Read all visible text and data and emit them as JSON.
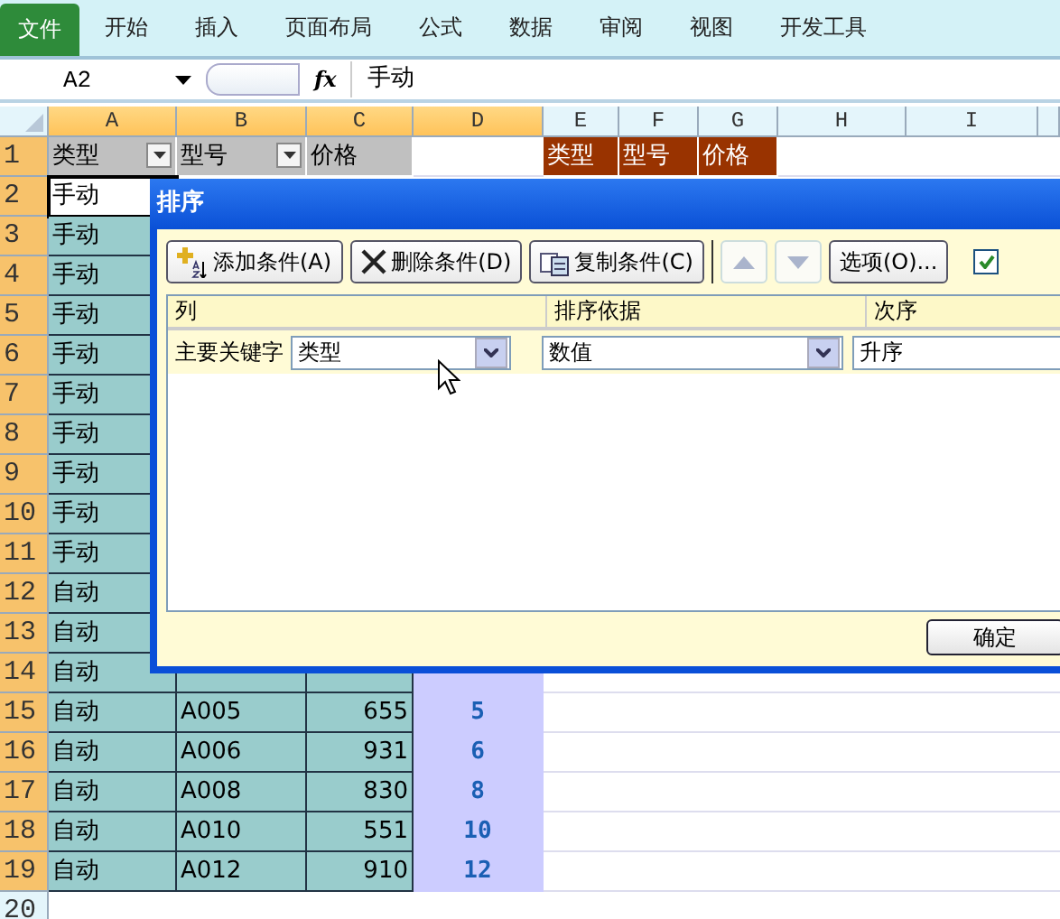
{
  "ribbon": {
    "tabs": [
      {
        "label": "文件",
        "selected": true
      },
      {
        "label": "开始",
        "selected": false
      },
      {
        "label": "插入",
        "selected": false
      },
      {
        "label": "页面布局",
        "selected": false
      },
      {
        "label": "公式",
        "selected": false
      },
      {
        "label": "数据",
        "selected": false
      },
      {
        "label": "审阅",
        "selected": false
      },
      {
        "label": "视图",
        "selected": false
      },
      {
        "label": "开发工具",
        "selected": false
      }
    ]
  },
  "formula_bar": {
    "name_box": "A2",
    "fx": "fx",
    "value": "手动"
  },
  "sheet": {
    "columns": [
      {
        "label": "A",
        "selected": true
      },
      {
        "label": "B",
        "selected": true
      },
      {
        "label": "C",
        "selected": true
      },
      {
        "label": "D",
        "selected": true
      },
      {
        "label": "E",
        "selected": false
      },
      {
        "label": "F",
        "selected": false
      },
      {
        "label": "G",
        "selected": false
      },
      {
        "label": "H",
        "selected": false
      },
      {
        "label": "I",
        "selected": false
      }
    ],
    "rows": [
      {
        "number": "1",
        "selected": true,
        "cells": {
          "A": {
            "kind": "field",
            "text": "类型",
            "filter": true
          },
          "B": {
            "kind": "field",
            "text": "型号",
            "filter": true
          },
          "C": {
            "kind": "field",
            "text": "价格"
          },
          "E": {
            "kind": "criteria",
            "text": "类型"
          },
          "F": {
            "kind": "criteria",
            "text": "型号"
          },
          "G": {
            "kind": "criteria",
            "text": "价格"
          }
        }
      },
      {
        "number": "2",
        "selected": true,
        "cells": {
          "A": {
            "kind": "text",
            "text": "手动",
            "active": true
          }
        }
      },
      {
        "number": "3",
        "selected": true,
        "cells": {
          "A": {
            "kind": "text",
            "text": "手动",
            "active": false
          }
        }
      },
      {
        "number": "4",
        "selected": true,
        "cells": {
          "A": {
            "kind": "text",
            "text": "手动",
            "active": false
          }
        }
      },
      {
        "number": "5",
        "selected": true,
        "cells": {
          "A": {
            "kind": "text",
            "text": "手动",
            "active": false
          }
        }
      },
      {
        "number": "6",
        "selected": true,
        "cells": {
          "A": {
            "kind": "text",
            "text": "手动",
            "active": false
          }
        }
      },
      {
        "number": "7",
        "selected": true,
        "cells": {
          "A": {
            "kind": "text",
            "text": "手动",
            "active": false
          }
        }
      },
      {
        "number": "8",
        "selected": true,
        "cells": {
          "A": {
            "kind": "text",
            "text": "手动",
            "active": false
          }
        }
      },
      {
        "number": "9",
        "selected": true,
        "cells": {
          "A": {
            "kind": "text",
            "text": "手动",
            "active": false
          }
        }
      },
      {
        "number": "10",
        "selected": true,
        "cells": {
          "A": {
            "kind": "text",
            "text": "手动",
            "active": false
          }
        }
      },
      {
        "number": "11",
        "selected": true,
        "cells": {
          "A": {
            "kind": "text",
            "text": "手动",
            "active": false
          }
        }
      },
      {
        "number": "12",
        "selected": true,
        "cells": {
          "A": {
            "kind": "text",
            "text": "自动",
            "active": false
          }
        }
      },
      {
        "number": "13",
        "selected": true,
        "cells": {
          "A": {
            "kind": "text",
            "text": "自动",
            "active": false
          }
        }
      },
      {
        "number": "14",
        "selected": true,
        "cells": {
          "A": {
            "kind": "text",
            "text": "自动",
            "active": false
          },
          "B": {
            "kind": "text",
            "active": false
          },
          "C": {
            "kind": "number",
            "active": false
          },
          "D": {
            "kind": "rank",
            "active": false
          }
        }
      },
      {
        "number": "15",
        "selected": true,
        "cells": {
          "A": {
            "kind": "text",
            "text": "自动",
            "active": false
          },
          "B": {
            "kind": "text",
            "text": "A005",
            "active": false
          },
          "C": {
            "kind": "number",
            "text": "655",
            "active": false
          },
          "D": {
            "kind": "rank",
            "text": "5",
            "active": false
          }
        }
      },
      {
        "number": "16",
        "selected": true,
        "cells": {
          "A": {
            "kind": "text",
            "text": "自动",
            "active": false
          },
          "B": {
            "kind": "text",
            "text": "A006",
            "active": false
          },
          "C": {
            "kind": "number",
            "text": "931",
            "active": false
          },
          "D": {
            "kind": "rank",
            "text": "6",
            "active": false
          }
        }
      },
      {
        "number": "17",
        "selected": true,
        "cells": {
          "A": {
            "kind": "text",
            "text": "自动",
            "active": false
          },
          "B": {
            "kind": "text",
            "text": "A008",
            "active": false
          },
          "C": {
            "kind": "number",
            "text": "830",
            "active": false
          },
          "D": {
            "kind": "rank",
            "text": "8",
            "active": false
          }
        }
      },
      {
        "number": "18",
        "selected": true,
        "cells": {
          "A": {
            "kind": "text",
            "text": "自动",
            "active": false
          },
          "B": {
            "kind": "text",
            "text": "A010",
            "active": false
          },
          "C": {
            "kind": "number",
            "text": "551",
            "active": false
          },
          "D": {
            "kind": "rank",
            "text": "10",
            "active": false
          }
        }
      },
      {
        "number": "19",
        "selected": true,
        "cells": {
          "A": {
            "kind": "text",
            "text": "自动",
            "active": false
          },
          "B": {
            "kind": "text",
            "text": "A012",
            "active": false
          },
          "C": {
            "kind": "number",
            "text": "910",
            "active": false
          },
          "D": {
            "kind": "rank",
            "text": "12",
            "active": false
          }
        }
      },
      {
        "number": "20",
        "selected": false,
        "cells": {}
      }
    ]
  },
  "dialog": {
    "title": "排序",
    "buttons": [
      {
        "kind": "add",
        "label": "添加条件(A)",
        "disabled": false
      },
      {
        "kind": "delete",
        "label": "删除条件(D)",
        "disabled": false
      },
      {
        "kind": "copy",
        "label": "复制条件(C)",
        "disabled": false
      },
      {
        "kind": "up",
        "disabled": true
      },
      {
        "kind": "down",
        "disabled": true
      },
      {
        "kind": "options",
        "label": "选项(O)...",
        "disabled": false
      }
    ],
    "header_checkbox": {
      "checked": true
    },
    "columns": [
      "列",
      "排序依据",
      "次序"
    ],
    "rows": [
      {
        "label": "主要关键字",
        "column": "类型",
        "sort_on": "数值",
        "order": "升序"
      }
    ],
    "ok": "确定"
  }
}
